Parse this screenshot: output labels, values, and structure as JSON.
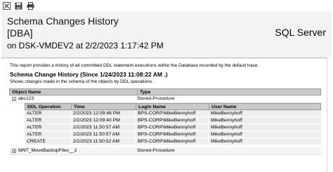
{
  "toolbar": {
    "icons": [
      "expand-collapse-icon",
      "save-icon",
      "print-icon"
    ]
  },
  "report": {
    "title": "Schema Changes History",
    "database": "[DBA]",
    "subtitle": "on DSK-VMDEV2 at 2/2/2023 1:17:42 PM",
    "server_label": "SQL Server",
    "description": "This report provides a history of all committed DDL statement executions within the Database recorded by the default trace.",
    "section_title": "Schema Change History (Since 1/24/2023 11:08:22 AM .)",
    "section_subtitle": "Shows changes made in the schema of the objects by DDL operations."
  },
  "grid": {
    "headers": {
      "object_name": "Object Name",
      "type": "Type"
    },
    "inner_headers": {
      "ddl_operation": "DDL Operation",
      "time": "Time",
      "login_name": "Login Name",
      "user_name": "User Name"
    },
    "objects": [
      {
        "name": "abc123",
        "type": "Stored-Procedure",
        "expanded": true,
        "rows": [
          {
            "op": "ALTER",
            "time": "2/2/2023 12:09:48 PM",
            "login": "BPS-CORP\\MikeBennyhoff",
            "user": "MikeBennyhoff"
          },
          {
            "op": "ALTER",
            "time": "2/2/2023 12:09:40 PM",
            "login": "BPS-CORP\\MikeBennyhoff",
            "user": "MikeBennyhoff"
          },
          {
            "op": "ALTER",
            "time": "2/2/2023 11:50:57 AM",
            "login": "BPS-CORP\\MikeBennyhoff",
            "user": "MikeBennyhoff"
          },
          {
            "op": "ALTER",
            "time": "2/2/2023 11:50:57 AM",
            "login": "BPS-CORP\\MikeBennyhoff",
            "user": "MikeBennyhoff"
          },
          {
            "op": "CREATE",
            "time": "2/2/2023 11:50:52 AM",
            "login": "BPS-CORP\\MikeBennyhoff",
            "user": "MikeBennyhoff"
          }
        ]
      },
      {
        "name": "MNT_MoveBackupFiles__2",
        "type": "Stored-Procedure",
        "expanded": false,
        "rows": []
      }
    ]
  }
}
